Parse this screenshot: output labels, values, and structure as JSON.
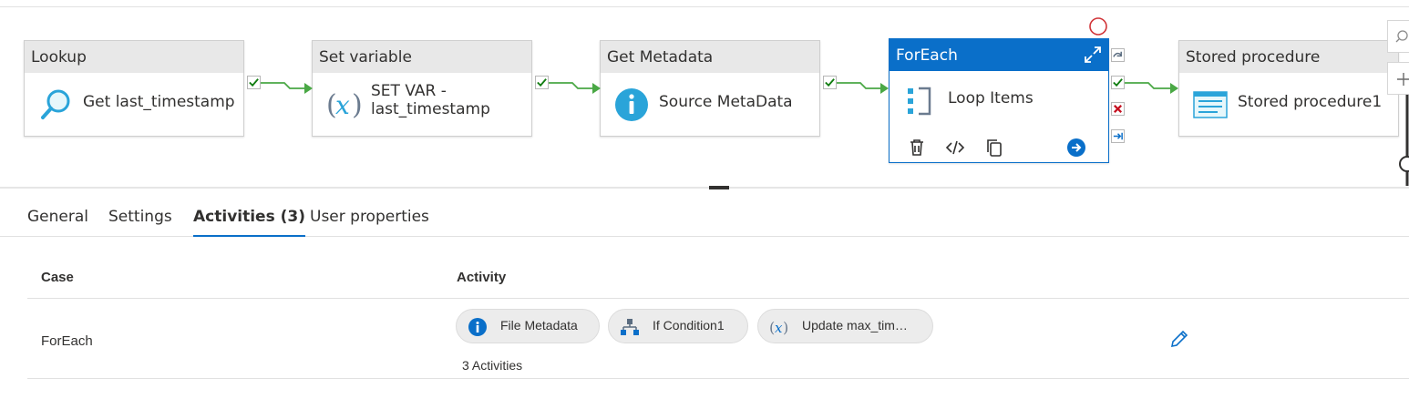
{
  "pipeline": {
    "activities": [
      {
        "type": "Lookup",
        "name": "Get last_timestamp",
        "icon": "lookup-icon"
      },
      {
        "type": "Set variable",
        "name_line1": "SET VAR -",
        "name_line2": "last_timestamp",
        "icon": "variable-icon"
      },
      {
        "type": "Get Metadata",
        "name": "Source MetaData",
        "icon": "info-icon"
      },
      {
        "type": "ForEach",
        "name": "Loop Items",
        "icon": "foreach-icon"
      },
      {
        "type": "Stored procedure",
        "name": "Stored procedure1",
        "icon": "stored-procedure-icon"
      }
    ],
    "colors": {
      "accent": "#0a6fc9",
      "success": "#107c10",
      "failure": "#c50f1f",
      "error_circle": "#d13438"
    }
  },
  "tabs": [
    {
      "label": "General"
    },
    {
      "label": "Settings"
    },
    {
      "label": "Activities (3)",
      "active": true
    },
    {
      "label": "User properties"
    }
  ],
  "activities_table": {
    "headers": {
      "case": "Case",
      "activity": "Activity"
    },
    "rows": [
      {
        "case": "ForEach",
        "activities": [
          {
            "label": "File Metadata",
            "icon": "info-icon"
          },
          {
            "label": "If Condition1",
            "icon": "if-condition-icon"
          },
          {
            "label": "Update max_tim…",
            "icon": "variable-icon"
          }
        ],
        "count_text": "3 Activities"
      }
    ]
  }
}
